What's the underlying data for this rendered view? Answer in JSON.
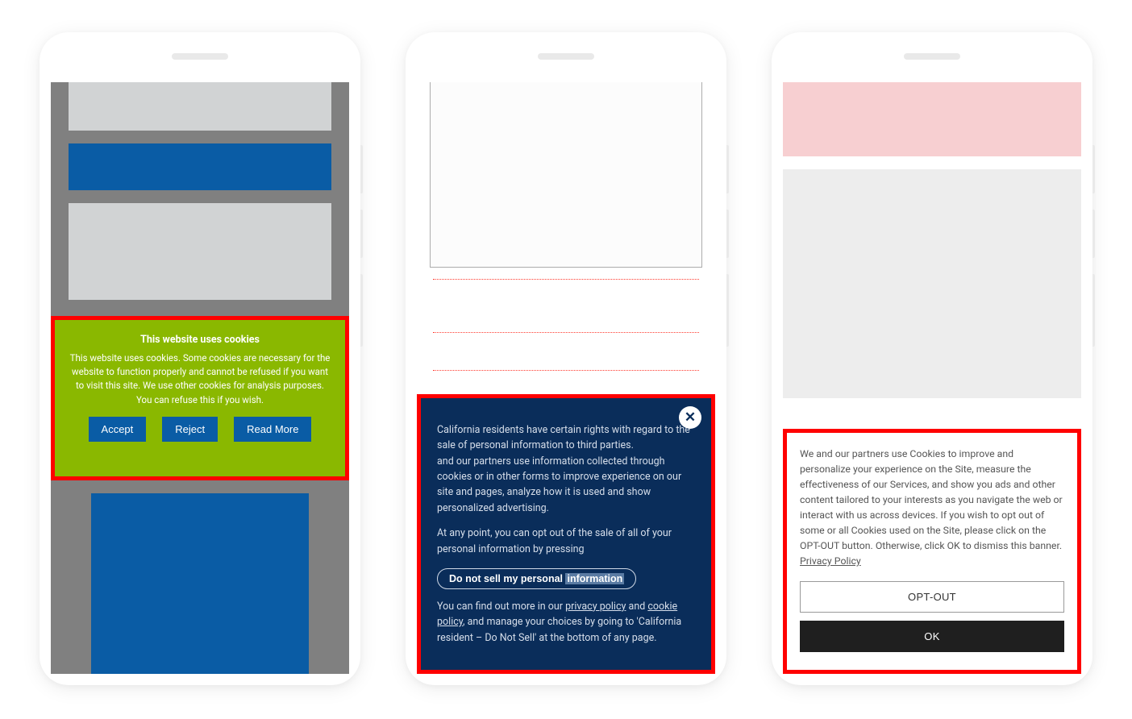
{
  "phone1": {
    "banner": {
      "title": "This website uses cookies",
      "body": "This website uses cookies. Some cookies are necessary for the website to function properly and cannot be refused if you want to visit this site. We use other cookies for analysis purposes. You can refuse this if you wish.",
      "accept_label": "Accept",
      "reject_label": "Reject",
      "readmore_label": "Read More"
    }
  },
  "phone2": {
    "banner": {
      "para1_a": "California residents have certain rights with regard to the sale of personal information to third parties.",
      "para1_b": "and our partners use information collected through cookies or in other forms to improve experience on our site and pages, analyze how it is used and show personalized advertising.",
      "para2": "At any point, you can opt out of the sale of all of your personal information by pressing",
      "pill_prefix": "Do not sell my personal ",
      "pill_highlight": "information",
      "para3_a": "You can find out more in our ",
      "link_privacy": "privacy policy",
      "para3_and": " and ",
      "link_cookie": "cookie policy",
      "para3_b": ", and manage your choices by going to 'California resident – Do Not Sell' at the bottom of any page."
    }
  },
  "phone3": {
    "banner": {
      "body": "We and our partners use Cookies to improve and personalize your experience on the Site, measure the effectiveness of our Services, and show you ads and other content tailored to your interests as you navigate the web or interact with us across devices. If you wish to opt out of some or all Cookies used on the Site, please click on the OPT-OUT button. Otherwise, click OK to dismiss this banner. ",
      "link_privacy": "Privacy Policy",
      "optout_label": "OPT-OUT",
      "ok_label": "OK"
    }
  }
}
